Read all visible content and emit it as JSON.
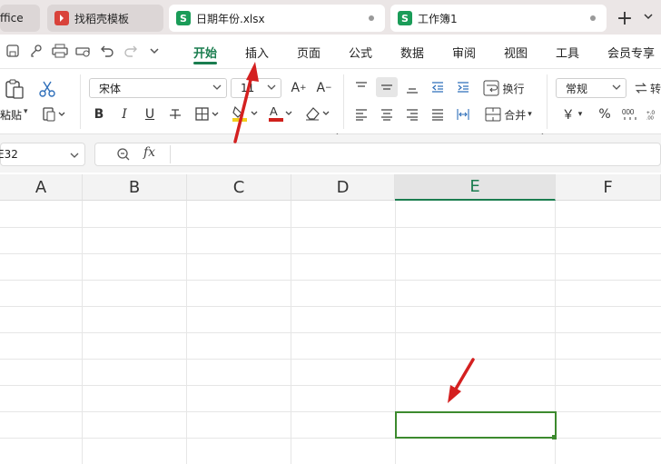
{
  "tabs": [
    {
      "label": "ffice",
      "state": "inactive"
    },
    {
      "label": "找稻壳模板",
      "state": "inactive",
      "icon": "wps-docer-icon",
      "icon_color": "#d9433b"
    },
    {
      "label": "日期年份.xlsx",
      "state": "active",
      "icon": "spreadsheet-s-icon",
      "icon_color": "#1a9c58",
      "icon_letter": "S"
    },
    {
      "label": "工作簿1",
      "state": "active",
      "icon": "spreadsheet-s-icon",
      "icon_color": "#1a9c58",
      "icon_letter": "S"
    }
  ],
  "tab_add_label": "+",
  "menu": {
    "items": [
      "开始",
      "插入",
      "页面",
      "公式",
      "数据",
      "审阅",
      "视图",
      "工具",
      "会员专享"
    ],
    "active": "开始"
  },
  "ribbon": {
    "paste_label": "粘贴",
    "font_name": "宋体",
    "font_size": "11",
    "wrap_label": "换行",
    "merge_label": "合并",
    "number_format": "常规",
    "currency_symbol": "￥",
    "percent_symbol": "%",
    "bold": "B",
    "italic": "I",
    "underline": "U",
    "convert_label": "转"
  },
  "formula_bar": {
    "name_box": "E32",
    "fx_label": "fx"
  },
  "sheet": {
    "columns": [
      "A",
      "B",
      "C",
      "D",
      "E",
      "F"
    ],
    "selected_column": "E"
  },
  "colors": {
    "accent": "#1a7d4f",
    "selection": "#3c8a2e",
    "annotation_arrow": "#d42020"
  }
}
